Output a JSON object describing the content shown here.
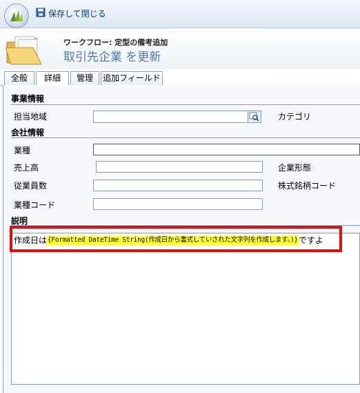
{
  "toolbar": {
    "save_close_label": "保存して閉じる"
  },
  "header": {
    "workflow_label": "ワークフロー: 定型の備考追加",
    "title": "取引先企業 を更新"
  },
  "tabs": [
    {
      "label": "全般"
    },
    {
      "label": "詳細"
    },
    {
      "label": "管理"
    },
    {
      "label": "追加フィールド"
    }
  ],
  "sections": {
    "business": {
      "title": "事業情報",
      "region_label": "担当地域",
      "category_label": "カテゴリ"
    },
    "company": {
      "title": "会社情報",
      "industry_label": "業種",
      "revenue_label": "売上高",
      "ownership_label": "企業形態",
      "employees_label": "従業員数",
      "ticker_label": "株式銘柄コード",
      "sic_label": "業種コード"
    },
    "description": {
      "title": "説明",
      "prefix": "作成日は",
      "token": "{Formatted DateTime String(作成日から書式していされた文字列を作成します。)}",
      "suffix": "ですよ"
    }
  },
  "colors": {
    "highlight_border": "#e01010",
    "token_bg": "#ffff33",
    "title_blue": "#4d7ab0"
  }
}
